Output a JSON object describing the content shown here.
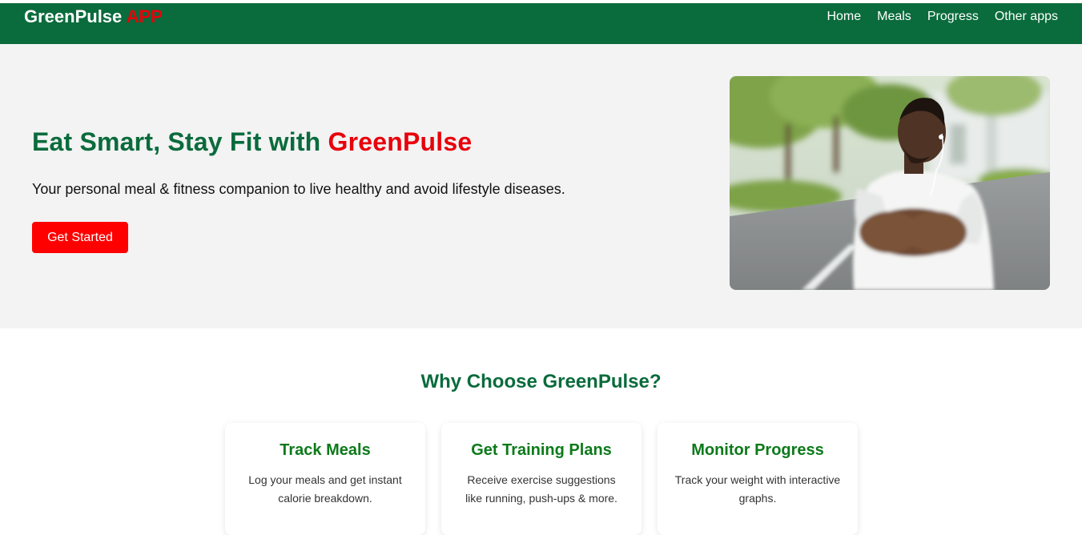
{
  "navbar": {
    "brand_main": "GreenPulse",
    "brand_accent": "APP",
    "links": [
      {
        "label": "Home"
      },
      {
        "label": "Meals"
      },
      {
        "label": "Progress"
      },
      {
        "label": "Other apps"
      }
    ]
  },
  "hero": {
    "title_main": "Eat Smart, Stay Fit with",
    "title_accent": "GreenPulse",
    "subtitle": "Your personal meal & fitness companion to live healthy and avoid lifestyle diseases.",
    "cta_label": "Get Started"
  },
  "features": {
    "title": "Why Choose GreenPulse?",
    "cards": [
      {
        "title": "Track Meals",
        "text": "Log your meals and get instant calorie breakdown."
      },
      {
        "title": "Get Training Plans",
        "text": "Receive exercise suggestions like running, push-ups & more."
      },
      {
        "title": "Monitor Progress",
        "text": "Track your weight with interactive graphs."
      }
    ]
  },
  "colors": {
    "brand_green": "#0a6b3c",
    "accent_red": "#e8000b",
    "card_title_green": "#0c7a1a",
    "hero_bg": "#f3f3f3"
  }
}
